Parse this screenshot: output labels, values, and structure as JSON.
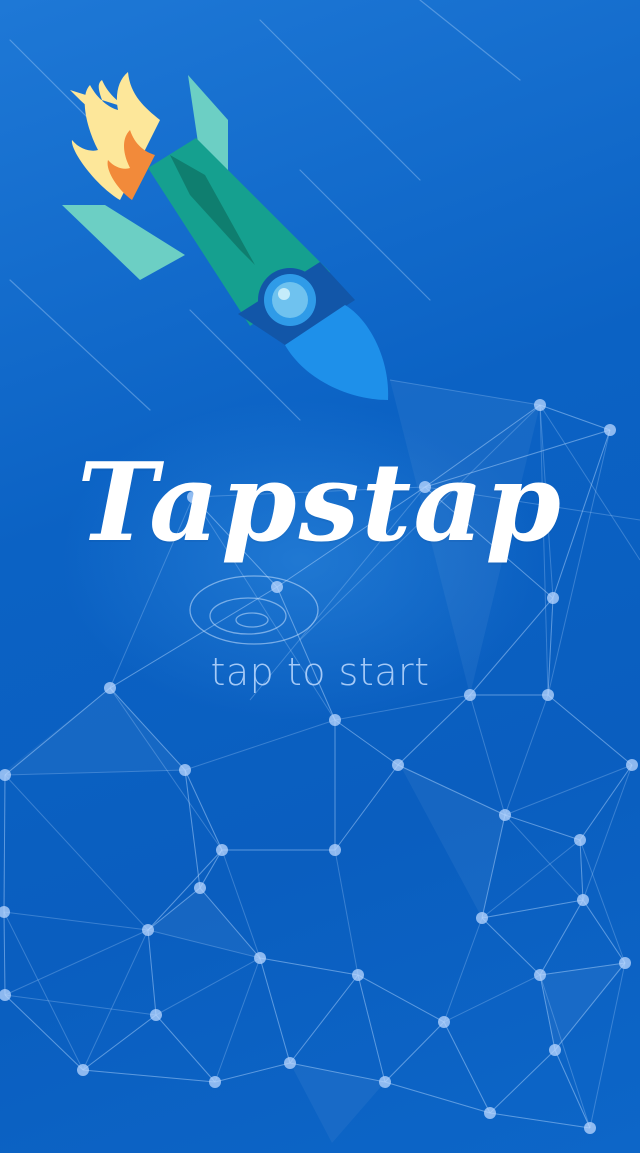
{
  "app": {
    "title": "Tapstap",
    "start_hint": "tap to start"
  },
  "colors": {
    "background": "#0b62c4",
    "rocket_body": "#15a08f",
    "rocket_fins": "#6ccfc4",
    "rocket_nose": "#1e90ea",
    "flame_outer": "#fde79a",
    "flame_inner": "#f28a3a",
    "text": "#ffffff"
  },
  "icons": {
    "rocket": "rocket-icon",
    "tap": "tap-ripple-icon"
  }
}
